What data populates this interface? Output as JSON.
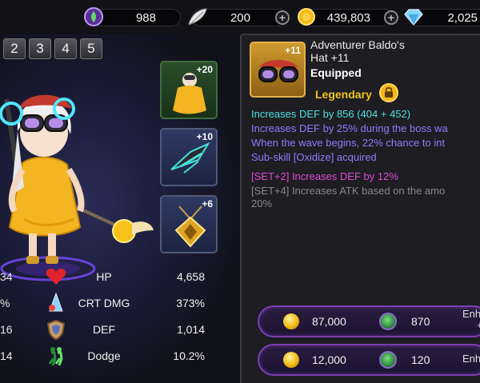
{
  "currency": {
    "stamina": "988",
    "feather": "200",
    "gold": "439,803",
    "diamond": "2,025"
  },
  "tabs": [
    "2",
    "3",
    "4",
    "5"
  ],
  "slots": [
    {
      "level": "+20",
      "icon": "costume-icon"
    },
    {
      "level": "+10",
      "icon": "weapon-wing-icon"
    },
    {
      "level": "+6",
      "icon": "amulet-icon"
    }
  ],
  "stats": [
    {
      "left": "34",
      "name": "HP",
      "value": "4,658",
      "icon": "heart-icon"
    },
    {
      "left": "%",
      "name": "CRT DMG",
      "value": "373%",
      "icon": "crit-damage-icon"
    },
    {
      "left": "16",
      "name": "DEF",
      "value": "1,014",
      "icon": "shield-icon"
    },
    {
      "left": "14",
      "name": "Dodge",
      "value": "10.2%",
      "icon": "dodge-icon"
    }
  ],
  "item": {
    "level": "+11",
    "name_line1": "Adventurer Baldo's",
    "name_line2": "Hat +11",
    "status": "Equipped",
    "rarity": "Legendary",
    "descriptions": [
      {
        "text": "Increases DEF by 856 (404 + 452)",
        "color": "#4fe0e0"
      },
      {
        "text": "Increases DEF by 25% during the boss wa",
        "color": "#8f7dff"
      },
      {
        "text": "When the wave begins, 22% chance to int",
        "color": "#8f7dff"
      },
      {
        "text": "Sub-skill [Oxidize] acquired",
        "color": "#8f7dff"
      },
      {
        "text": "[SET+2] Increases DEF by 12%",
        "color": "#e24ad8"
      },
      {
        "text": "[SET+4] Increases ATK based on the amo",
        "color": "#8a8a8a"
      },
      {
        "text": "20%",
        "color": "#8a8a8a"
      }
    ]
  },
  "costs": [
    {
      "gold": "87,000",
      "gems": "870",
      "label_line1": "Enh",
      "label_line2": "+"
    },
    {
      "gold": "12,000",
      "gems": "120",
      "label_line1": "Enh",
      "label_line2": ""
    }
  ]
}
